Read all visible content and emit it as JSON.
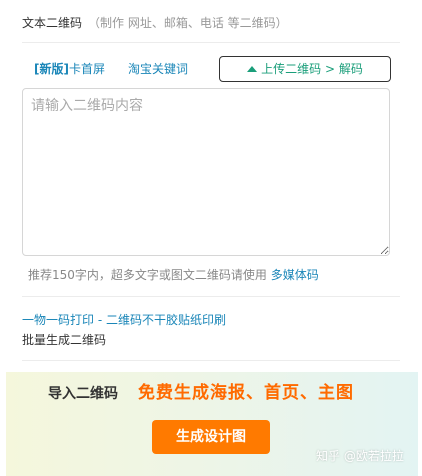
{
  "header": {
    "title": "文本二维码",
    "hint": "（制作 网址、邮箱、电话 等二维码）"
  },
  "tabs": {
    "new_open": "[",
    "new_label": "新版",
    "new_close": "]",
    "card_screen": "卡首屏",
    "taobao": "淘宝关键词",
    "upload": "上传二维码 > 解码"
  },
  "input": {
    "placeholder": "请输入二维码内容",
    "value": ""
  },
  "note": {
    "text": "推荐150字内，超多文字或图文二维码请使用 ",
    "link": "多媒体码"
  },
  "links": {
    "print": "一物一码打印 - 二维码不干胶贴纸印刷",
    "batch": "批量生成二维码"
  },
  "banner": {
    "import": "导入二维码",
    "promo": "免费生成海报、首页、主图",
    "button": "生成设计图",
    "watermark": "知乎 @欧若拉拉"
  },
  "colors": {
    "link_blue": "#1a86b8",
    "upload_green": "#1a9e7a",
    "promo_orange": "#ff6a00",
    "button_orange": "#ff7a00"
  },
  "icons": {
    "upload": "eject-icon"
  }
}
